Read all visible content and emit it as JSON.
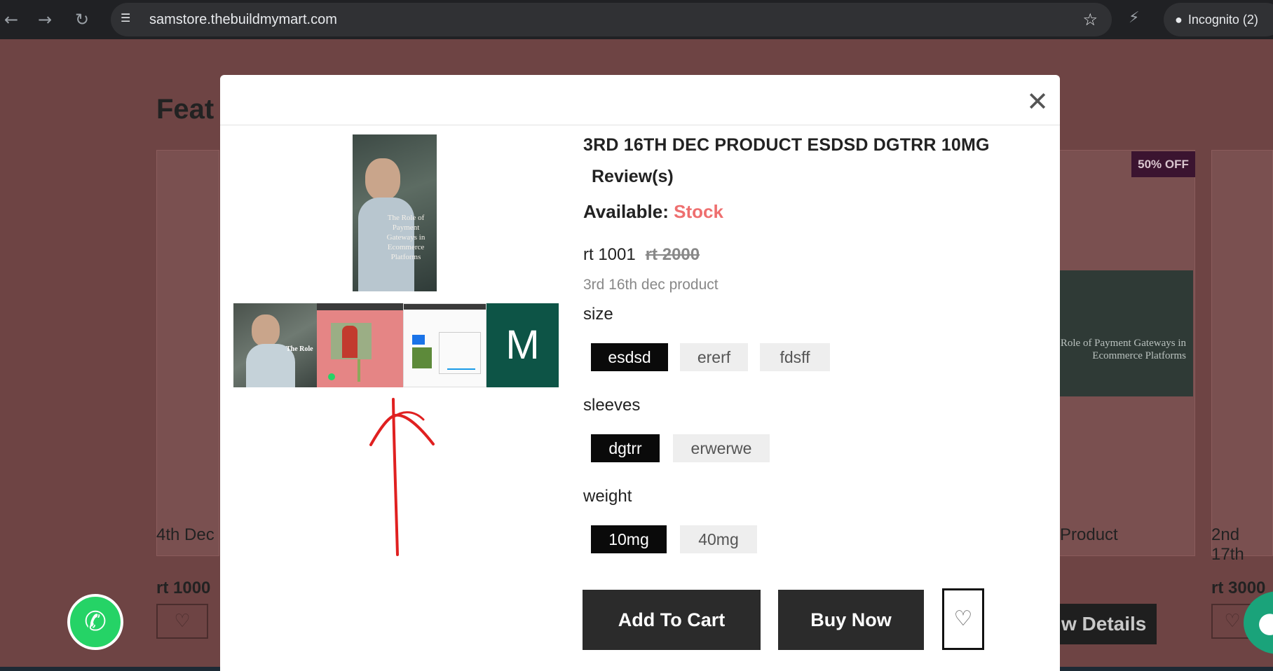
{
  "browser": {
    "url": "samstore.thebuildmymart.com",
    "profile_label": "Incognito (2)",
    "icons": [
      "back-icon",
      "forward-icon",
      "reload-icon",
      "site-info-icon",
      "star-icon",
      "extension-icon",
      "incognito-icon"
    ]
  },
  "background_page": {
    "heading": "Feat",
    "cards": [
      {
        "name": "4th Dec",
        "price": "rt 1000"
      },
      {
        "name": "Product",
        "badge": "50% OFF",
        "banner_text": "Role of Payment Gateways in Ecommerce Platforms",
        "button": "w Details"
      },
      {
        "name": "2nd 17th",
        "price": "rt 3000"
      }
    ]
  },
  "modal": {
    "title": "3RD 16TH DEC PRODUCT ESDSD DGTRR 10MG",
    "review_label": "Review(s)",
    "available_label": "Available:",
    "available_value": "Stock",
    "price": "rt 1001",
    "old_price": "rt 2000",
    "description": "3rd 16th dec product",
    "main_image_caption": "The Role of Payment Gateways in Ecommerce Platforms",
    "thumbnails": [
      {
        "caption": "The Role"
      },
      {
        "caption": ""
      },
      {
        "caption": ""
      },
      {
        "caption": "M"
      }
    ],
    "options": [
      {
        "label": "size",
        "values": [
          "esdsd",
          "ererf",
          "fdsff"
        ],
        "selected": "esdsd"
      },
      {
        "label": "sleeves",
        "values": [
          "dgtrr",
          "erwerwe"
        ],
        "selected": "dgtrr"
      },
      {
        "label": "weight",
        "values": [
          "10mg",
          "40mg"
        ],
        "selected": "10mg"
      }
    ],
    "add_to_cart": "Add To Cart",
    "buy_now": "Buy Now",
    "colors": {
      "accent_stock": "#ee6f6f",
      "selected_option": "#0a0a0a",
      "button": "#2b2b2b",
      "annotation_arrow": "#e02020"
    }
  }
}
